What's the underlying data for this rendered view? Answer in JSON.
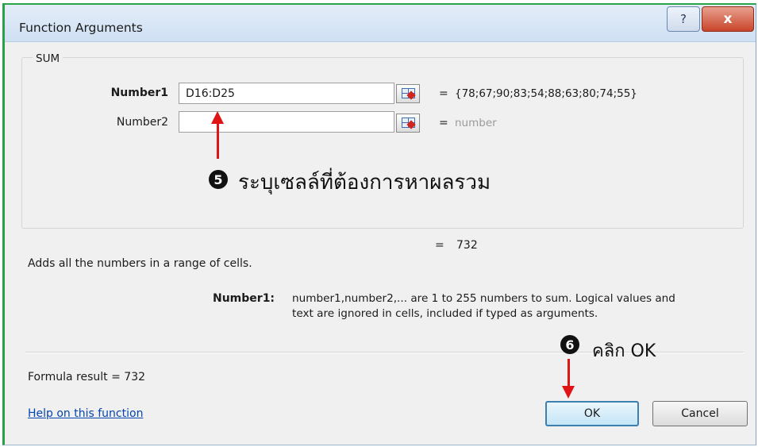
{
  "window": {
    "title": "Function Arguments",
    "help_glyph": "?",
    "close_glyph": "x"
  },
  "group": {
    "function_name": "SUM",
    "args": [
      {
        "label": "Number1",
        "value": "D16:D25",
        "result_eq": "=",
        "result": "{78;67;90;83;54;88;63;80;74;55}"
      },
      {
        "label": "Number2",
        "value": "",
        "result_eq": "=",
        "result": "number"
      }
    ]
  },
  "annotations": {
    "step5_number": "5",
    "step5_text": "ระบุเซลล์ที่ต้องการหาผลรวม",
    "step6_number": "6",
    "step6_text": "คลิก OK"
  },
  "total": {
    "eq": "=",
    "value": "732"
  },
  "description": "Adds all the numbers in a range of cells.",
  "arg_help": {
    "label": "Number1:",
    "line1": "number1,number2,... are 1 to 255 numbers to sum. Logical values and",
    "line2": "text are ignored in cells, included if typed as arguments."
  },
  "footer": {
    "formula_result": "Formula result =   732",
    "help_link": "Help on this function",
    "ok_label": "OK",
    "cancel_label": "Cancel"
  },
  "colors": {
    "accent_border": "#2aa24a",
    "annotation_arrow": "#e01414",
    "link": "#0645ad"
  },
  "icons": {
    "ref_button": "range-selector-icon",
    "help": "question-icon",
    "close": "close-icon"
  }
}
